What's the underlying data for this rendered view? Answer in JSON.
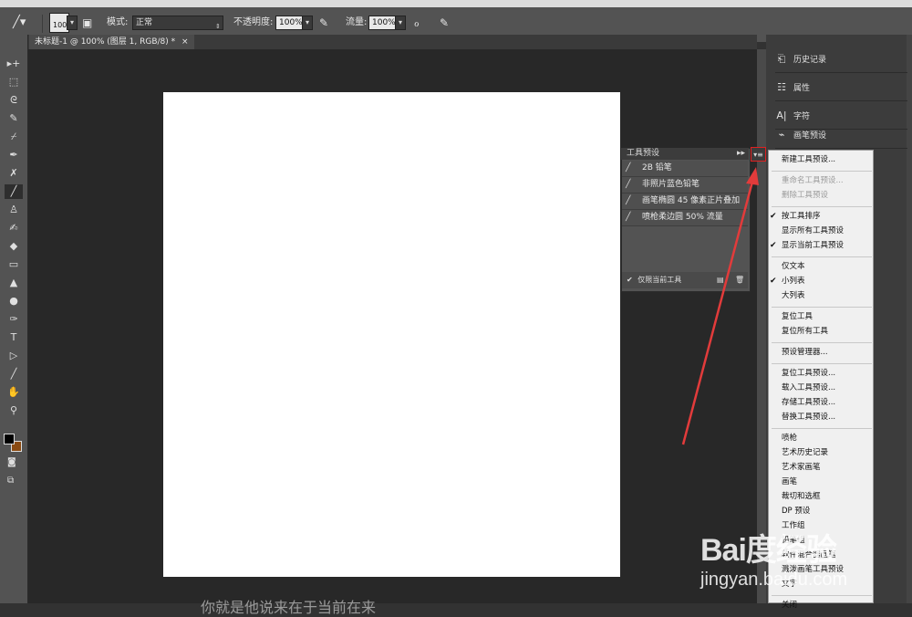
{
  "options_bar": {
    "brush_size": "100",
    "mode_label": "模式:",
    "mode_value": "正常",
    "opacity_label": "不透明度:",
    "opacity_value": "100%",
    "flow_label": "流量:",
    "flow_value": "100%"
  },
  "document": {
    "tab_title": "未标题-1 @ 100% (图层 1, RGB/8) *",
    "close_glyph": "×"
  },
  "tools": [
    {
      "name": "move",
      "glyph": "▸+"
    },
    {
      "name": "marquee",
      "glyph": "⬚"
    },
    {
      "name": "lasso",
      "glyph": "ᘓ"
    },
    {
      "name": "quick-select",
      "glyph": "✎"
    },
    {
      "name": "crop",
      "glyph": "⌿"
    },
    {
      "name": "eyedropper",
      "glyph": "✒"
    },
    {
      "name": "healing",
      "glyph": "✗"
    },
    {
      "name": "brush",
      "glyph": "╱"
    },
    {
      "name": "stamp",
      "glyph": "♙"
    },
    {
      "name": "history-brush",
      "glyph": "✍"
    },
    {
      "name": "eraser",
      "glyph": "◆"
    },
    {
      "name": "gradient",
      "glyph": "▭"
    },
    {
      "name": "blur",
      "glyph": "▲"
    },
    {
      "name": "dodge",
      "glyph": "●"
    },
    {
      "name": "pen",
      "glyph": "✑"
    },
    {
      "name": "type",
      "glyph": "T"
    },
    {
      "name": "path-select",
      "glyph": "▷"
    },
    {
      "name": "line",
      "glyph": "╱"
    },
    {
      "name": "hand",
      "glyph": "✋"
    },
    {
      "name": "zoom",
      "glyph": "⚲"
    }
  ],
  "right_panel": {
    "items": [
      {
        "label": "历史记录",
        "icon": "history-icon",
        "glyph": "⎗"
      },
      {
        "label": "属性",
        "icon": "properties-icon",
        "glyph": "☷"
      },
      {
        "label": "字符",
        "icon": "character-icon",
        "glyph": "A|"
      },
      {
        "label": "画笔预设",
        "icon": "brush-preset-icon",
        "glyph": "⌁"
      }
    ]
  },
  "tool_presets": {
    "title": "工具预设",
    "items": [
      "2B 铅笔",
      "非照片蓝色铅笔",
      "画笔椭圆 45 像素正片叠加",
      "喷枪柔边圆 50% 流量"
    ],
    "footer_label": "仅限当前工具"
  },
  "context_menu": {
    "items": [
      {
        "label": "新建工具预设...",
        "enabled": true,
        "checked": false,
        "group": 1
      },
      {
        "label": "重命名工具预设...",
        "enabled": false,
        "checked": false,
        "group": 2
      },
      {
        "label": "删除工具预设",
        "enabled": false,
        "checked": false,
        "group": 2
      },
      {
        "label": "按工具排序",
        "enabled": true,
        "checked": true,
        "group": 3
      },
      {
        "label": "显示所有工具预设",
        "enabled": true,
        "checked": false,
        "group": 3
      },
      {
        "label": "显示当前工具预设",
        "enabled": true,
        "checked": true,
        "group": 3
      },
      {
        "label": "仅文本",
        "enabled": true,
        "checked": false,
        "group": 4
      },
      {
        "label": "小列表",
        "enabled": true,
        "checked": true,
        "group": 4
      },
      {
        "label": "大列表",
        "enabled": true,
        "checked": false,
        "group": 4
      },
      {
        "label": "复位工具",
        "enabled": true,
        "checked": false,
        "group": 5
      },
      {
        "label": "复位所有工具",
        "enabled": true,
        "checked": false,
        "group": 5
      },
      {
        "label": "预设管理器...",
        "enabled": true,
        "checked": false,
        "group": 6
      },
      {
        "label": "复位工具预设...",
        "enabled": true,
        "checked": false,
        "group": 7
      },
      {
        "label": "载入工具预设...",
        "enabled": true,
        "checked": false,
        "group": 7
      },
      {
        "label": "存储工具预设...",
        "enabled": true,
        "checked": false,
        "group": 7
      },
      {
        "label": "替换工具预设...",
        "enabled": true,
        "checked": false,
        "group": 7
      },
      {
        "label": "喷枪",
        "enabled": true,
        "checked": false,
        "group": 8
      },
      {
        "label": "艺术历史记录",
        "enabled": true,
        "checked": false,
        "group": 8
      },
      {
        "label": "艺术家画笔",
        "enabled": true,
        "checked": false,
        "group": 8
      },
      {
        "label": "画笔",
        "enabled": true,
        "checked": false,
        "group": 8
      },
      {
        "label": "裁切和选框",
        "enabled": true,
        "checked": false,
        "group": 8
      },
      {
        "label": "DP 预设",
        "enabled": true,
        "checked": false,
        "group": 8
      },
      {
        "label": "工作组",
        "enabled": true,
        "checked": false,
        "group": 8
      },
      {
        "label": "铅笔组",
        "enabled": true,
        "checked": false,
        "group": 8
      },
      {
        "label": "软件混合器画笔",
        "enabled": true,
        "checked": false,
        "group": 8
      },
      {
        "label": "溅泼画笔工具预设",
        "enabled": true,
        "checked": false,
        "group": 8
      },
      {
        "label": "文字",
        "enabled": true,
        "checked": false,
        "group": 8
      },
      {
        "label": "关闭",
        "enabled": true,
        "checked": false,
        "group": 9
      }
    ]
  },
  "watermark": {
    "brand": "Bai度经验",
    "url": "jingyan.baidu.com"
  },
  "caption_partial": "你就是他说来在于当前在来",
  "colors": {
    "annotation_arrow": "#e23b3b",
    "foreground": "#000000",
    "background": "#8a4a12"
  }
}
